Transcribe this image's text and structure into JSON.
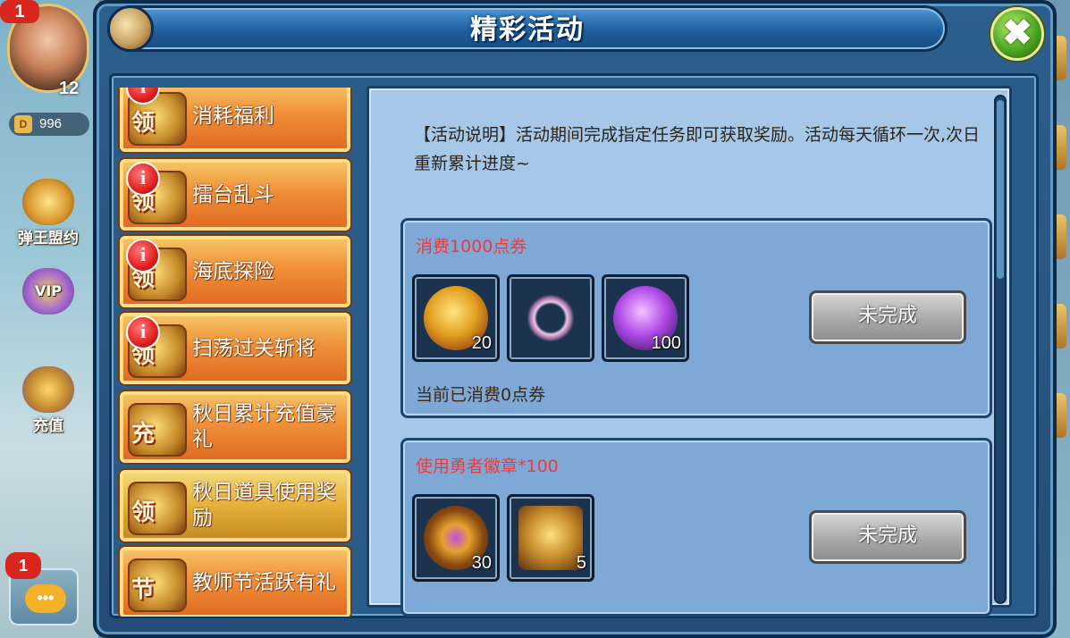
{
  "hud": {
    "avatar_badge": "1",
    "vip_level": "12",
    "vip_tag": "VIP",
    "currency_value": "996",
    "currency_symbol": "D",
    "side_buttons": [
      {
        "label": "弹王盟约",
        "icon": "scroll-icon"
      },
      {
        "label": "",
        "icon": "vip-wings-icon",
        "tag": "VIP"
      },
      {
        "label": "充值",
        "icon": "treasure-chest-icon"
      }
    ],
    "chat_badge": "1",
    "chat_bubble": "•••"
  },
  "dialog": {
    "title": "精彩活动",
    "close_glyph": "✖"
  },
  "activities": [
    {
      "label": "消耗福利",
      "icon_char": "领",
      "alert": "i"
    },
    {
      "label": "擂台乱斗",
      "icon_char": "领",
      "alert": "i"
    },
    {
      "label": "海底探险",
      "icon_char": "领",
      "alert": "i"
    },
    {
      "label": "扫荡过关斩将",
      "icon_char": "领",
      "alert": "i"
    },
    {
      "label": "秋日累计充值豪礼",
      "icon_char": "充",
      "alert": ""
    },
    {
      "label": "秋日道具使用奖励",
      "icon_char": "领",
      "alert": ""
    },
    {
      "label": "教师节活跃有礼",
      "icon_char": "节",
      "alert": ""
    }
  ],
  "content": {
    "description": "【活动说明】活动期间完成指定任务即可获取奖励。活动每天循环一次,次日重新累计进度~",
    "tasks": [
      {
        "title": "消费1000点券",
        "rewards": [
          {
            "icon": "gold-medal-icon",
            "count": "20"
          },
          {
            "icon": "ring-icon",
            "count": ""
          },
          {
            "icon": "purple-gem-icon",
            "count": "100"
          }
        ],
        "status": "未完成",
        "progress": "当前已消费0点券"
      },
      {
        "title": "使用勇者徽章*100",
        "rewards": [
          {
            "icon": "hero-badge-icon",
            "count": "30"
          },
          {
            "icon": "treasure-chest-icon",
            "count": "5"
          }
        ],
        "status": "未完成",
        "progress": ""
      }
    ]
  },
  "colors": {
    "task_title": "#f03a3a",
    "panel_bg": "#a7c7e8",
    "task_bg": "#7ea9d6",
    "item_orange": "#f09038"
  }
}
